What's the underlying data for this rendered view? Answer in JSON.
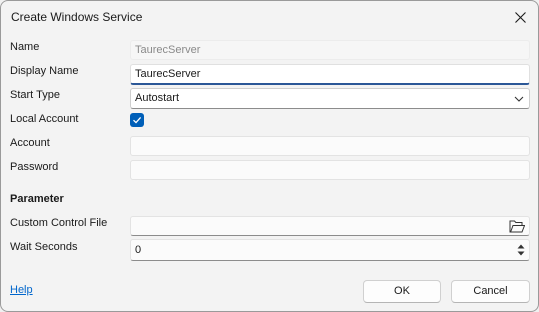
{
  "window": {
    "title": "Create Windows Service",
    "close_icon": "close-icon"
  },
  "form": {
    "name": {
      "label": "Name",
      "value": "TaurecServer"
    },
    "display_name": {
      "label": "Display Name",
      "value": "TaurecServer"
    },
    "start_type": {
      "label": "Start Type",
      "value": "Autostart",
      "icon": "chevron-down-icon"
    },
    "local_account": {
      "label": "Local Account",
      "checked": true
    },
    "account": {
      "label": "Account",
      "value": ""
    },
    "password": {
      "label": "Password",
      "value": ""
    }
  },
  "parameter": {
    "heading": "Parameter",
    "custom_control_file": {
      "label": "Custom Control File",
      "value": "",
      "icon": "folder-open-icon"
    },
    "wait_seconds": {
      "label": "Wait Seconds",
      "value": "0",
      "icon": "spinner-arrows-icon"
    }
  },
  "footer": {
    "help_label": "Help",
    "ok_label": "OK",
    "cancel_label": "Cancel"
  },
  "colors": {
    "accent": "#005fb8",
    "focus_underline": "#2b5797",
    "link": "#0066cc"
  }
}
